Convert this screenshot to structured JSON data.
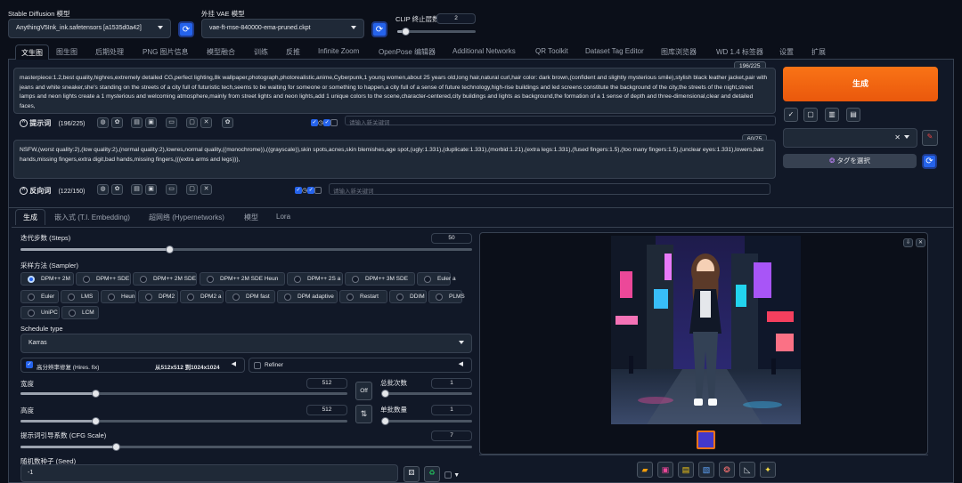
{
  "header": {
    "sd_model_label": "Stable Diffusion 模型",
    "sd_model_value": "AnythingV5Ink_ink.safetensors [a1535d0a42]",
    "vae_label": "外挂 VAE 模型",
    "vae_value": "vae-ft-mse-840000-ema-pruned.ckpt",
    "clip_label": "CLIP 终止层数",
    "clip_value": "2"
  },
  "tabs": [
    "文生图",
    "图生图",
    "后期处理",
    "PNG 图片信息",
    "模型融合",
    "训练",
    "反推",
    "Infinite Zoom",
    "OpenPose 编辑器",
    "Additional Networks",
    "QR Toolkit",
    "Dataset Tag Editor",
    "图库浏览器",
    "WD 1.4 标签器",
    "设置",
    "扩展"
  ],
  "prompt": {
    "counter": "196/225",
    "text": "masterpiece:1.2,best quality,highres,extremely detailed CG,perfect lighting,8k wallpaper,photograph,photorealistic,anime,Cyberpunk,1 young women,about 25 years old,long hair,natural curl,hair color: dark brown,(confident and slightly mysterious smile),stylish black leather jacket,pair with jeans and white sneaker,she's standing on the streets of a city full of futuristic tech,seems to be waiting for someone or something to happen,a city full of a sense of future technology,high-rise buildings and led screens constitute the background of the city,the streets of the night,street lamps and neon lights create a 1 mysterious and welcoming atmosphere,mainly from street lights and neon lights,add 1 unique colors to the scene,character-centered,city buildings and lights as background,the formation of a 1 sense of depth and three-dimensional,clear and detailed faces,",
    "toolbar_label": "提示词",
    "toolbar_count": "(196/225)",
    "new_keyword_placeholder": "请输入新关键词"
  },
  "negative": {
    "counter": "60/75",
    "text": "NSFW,(worst quality:2),(low quality:2),(normal quality:2),lowres,normal quality,((monochrome)),((grayscale)),skin spots,acnes,skin blemishes,age spot,(ugly:1.331),(duplicate:1.331),(morbid:1.21),(extra legs:1.331),(fused fingers:1.5),(too many fingers:1.5),(unclear eyes:1.331),lowers,bad hands,missing fingers,extra digit,bad hands,missing fingers,(((extra arms and legs))),",
    "toolbar_label": "反向词",
    "toolbar_count": "(122/150)",
    "new_keyword_placeholder": "请输入新关键词"
  },
  "right": {
    "generate_label": "生成",
    "tag_button_label": "タグを選択"
  },
  "subtabs": [
    "生成",
    "嵌入式 (T.I. Embedding)",
    "超网络 (Hypernetworks)",
    "模型",
    "Lora"
  ],
  "settings": {
    "steps_label": "迭代步数 (Steps)",
    "steps_value": "50",
    "steps_fraction": 0.33,
    "sampler_label": "采样方法 (Sampler)",
    "samplers": [
      "DPM++ 2M",
      "DPM++ SDE",
      "DPM++ 2M SDE",
      "DPM++ 2M SDE Heun",
      "DPM++ 2S a",
      "DPM++ 3M SDE",
      "Euler a",
      "Euler",
      "LMS",
      "Heun",
      "DPM2",
      "DPM2 a",
      "DPM fast",
      "DPM adaptive",
      "Restart",
      "DDIM",
      "PLMS",
      "UniPC",
      "LCM"
    ],
    "schedule_label": "Schedule type",
    "schedule_value": "Karras",
    "hires_label": "高分辨率修复 (Hires. fix)",
    "hires_info": "从512x512 到1024x1024",
    "refiner_label": "Refiner",
    "width_label": "宽度",
    "width_value": "512",
    "height_label": "高度",
    "height_value": "512",
    "off_label": "Off",
    "swap_icon": "swap-icon",
    "batch_count_label": "总批次数",
    "batch_count_value": "1",
    "batch_size_label": "单批数量",
    "batch_size_value": "1",
    "cfg_label": "提示词引导系数 (CFG Scale)",
    "cfg_value": "7",
    "seed_label": "随机数种子 (Seed)",
    "seed_value": "-1"
  },
  "colors": {
    "accent": "#f97316",
    "primary": "#2563eb",
    "background": "#0b0f19"
  }
}
